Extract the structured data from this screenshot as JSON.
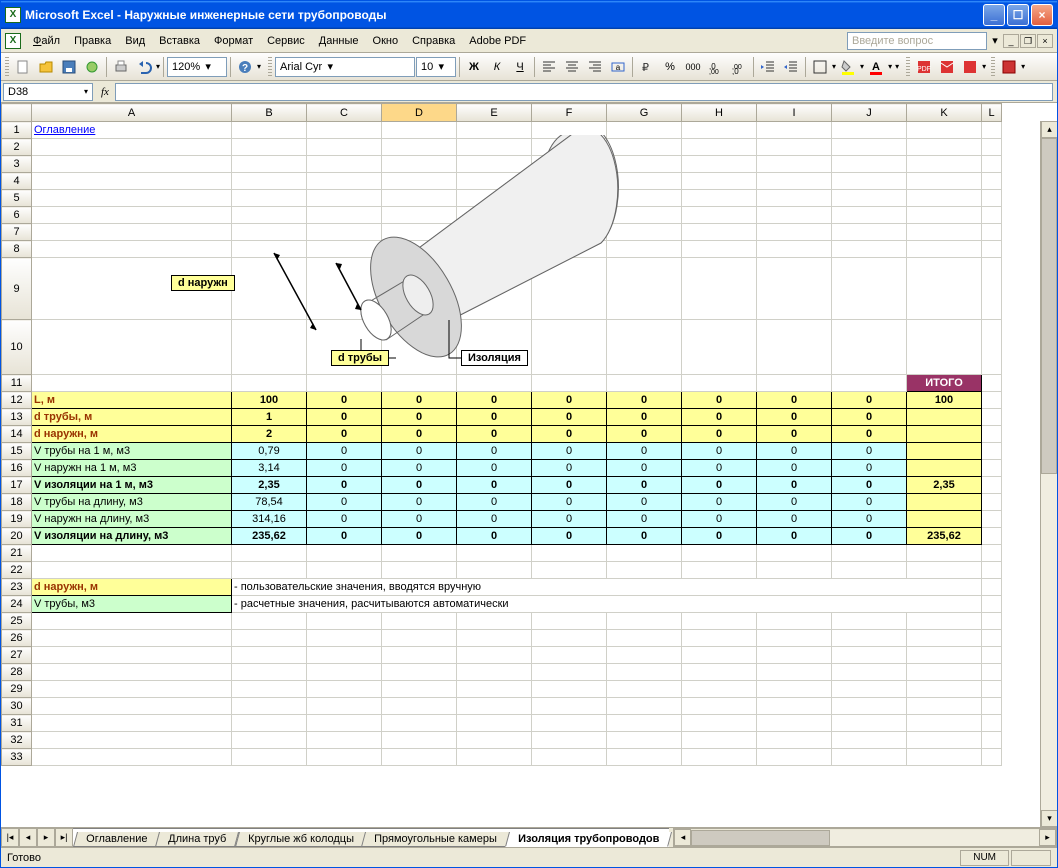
{
  "window": {
    "title": "Microsoft Excel - Наружные инженерные сети трубопроводы"
  },
  "menu": {
    "file": "Файл",
    "edit": "Правка",
    "view": "Вид",
    "insert": "Вставка",
    "format": "Формат",
    "service": "Сервис",
    "data": "Данные",
    "window": "Окно",
    "help": "Справка",
    "adobe": "Adobe PDF",
    "ask_placeholder": "Введите вопрос"
  },
  "toolbar": {
    "zoom": "120%",
    "font": "Arial Cyr",
    "font_size": "10"
  },
  "namebox": {
    "cell_ref": "D38",
    "fx": "fx"
  },
  "columns": [
    "A",
    "B",
    "C",
    "D",
    "E",
    "F",
    "G",
    "H",
    "I",
    "J",
    "K",
    "L"
  ],
  "active_col": "D",
  "rows": [
    "1",
    "2",
    "3",
    "4",
    "5",
    "6",
    "7",
    "8",
    "9",
    "10",
    "11",
    "12",
    "13",
    "14",
    "15",
    "16",
    "17",
    "18",
    "19",
    "20",
    "21",
    "22",
    "23",
    "24",
    "25",
    "26",
    "27",
    "28",
    "29",
    "30",
    "31",
    "32",
    "33"
  ],
  "diagram": {
    "d_outer": "d наружн",
    "d_pipe": "d трубы",
    "insulation": "Изоляция"
  },
  "cells": {
    "A1_link": "Оглавление",
    "K11": "ИТОГО",
    "labels": {
      "r12": "L, м",
      "r13": "d трубы, м",
      "r14": "d наружн, м",
      "r15": "V трубы на 1 м, м3",
      "r16": "V наружн на 1 м, м3",
      "r17": "V изоляции на 1 м, м3",
      "r18": "V трубы на длину, м3",
      "r19": "V наружн на длину, м3",
      "r20": "V изоляции  на длину, м3",
      "r23": "d наружн, м",
      "r24": "V трубы, м3"
    },
    "r12": [
      "100",
      "0",
      "0",
      "0",
      "0",
      "0",
      "0",
      "0",
      "0"
    ],
    "r12k": "100",
    "r13": [
      "1",
      "0",
      "0",
      "0",
      "0",
      "0",
      "0",
      "0",
      "0"
    ],
    "r13k": "",
    "r14": [
      "2",
      "0",
      "0",
      "0",
      "0",
      "0",
      "0",
      "0",
      "0"
    ],
    "r14k": "",
    "r15": [
      "0,79",
      "0",
      "0",
      "0",
      "0",
      "0",
      "0",
      "0",
      "0"
    ],
    "r15k": "",
    "r16": [
      "3,14",
      "0",
      "0",
      "0",
      "0",
      "0",
      "0",
      "0",
      "0"
    ],
    "r16k": "",
    "r17": [
      "2,35",
      "0",
      "0",
      "0",
      "0",
      "0",
      "0",
      "0",
      "0"
    ],
    "r17k": "2,35",
    "r18": [
      "78,54",
      "0",
      "0",
      "0",
      "0",
      "0",
      "0",
      "0",
      "0"
    ],
    "r18k": "",
    "r19": [
      "314,16",
      "0",
      "0",
      "0",
      "0",
      "0",
      "0",
      "0",
      "0"
    ],
    "r19k": "",
    "r20": [
      "235,62",
      "0",
      "0",
      "0",
      "0",
      "0",
      "0",
      "0",
      "0"
    ],
    "r20k": "235,62",
    "note23": "- пользовательские значения, вводятся вручную",
    "note24": "- расчетные значения, расчитываются автоматически"
  },
  "tabs": {
    "t1": "Оглавление",
    "t2": "Длина труб",
    "t3": "Круглые жб колодцы",
    "t4": "Прямоугольные камеры",
    "t5": "Изоляция трубопроводов"
  },
  "status": {
    "ready": "Готово",
    "num": "NUM"
  }
}
